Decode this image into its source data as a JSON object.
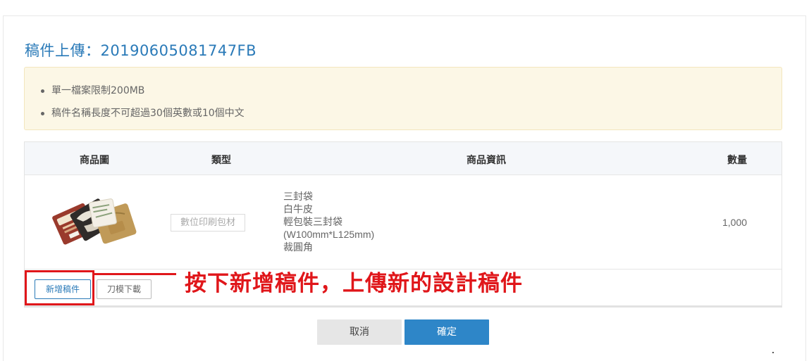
{
  "header": {
    "title_label": "稿件上傳：",
    "order_number": "20190605081747FB"
  },
  "notice": {
    "items": [
      "單一檔案限制200MB",
      "稿件名稱長度不可超過30個英數或10個中文"
    ]
  },
  "table": {
    "headers": {
      "image": "商品圖",
      "type": "類型",
      "info": "商品資訊",
      "quantity": "數量"
    },
    "rows": [
      {
        "type_tag": "數位印刷包材",
        "info_lines": [
          "三封袋",
          "白牛皮",
          "輕包裝三封袋",
          "(W100mm*L125mm)",
          "裁圓角"
        ],
        "quantity": "1,000"
      }
    ],
    "actions": {
      "add_file": "新增稿件",
      "download_template": "刀模下載"
    }
  },
  "annotation": {
    "text": "按下新增稿件，上傳新的設計稿件",
    "color": "#e0161a"
  },
  "footer": {
    "cancel": "取消",
    "confirm": "確定"
  },
  "colors": {
    "accent": "#2e86c8",
    "title": "#2a7ab8",
    "notice_bg": "#fcf7e6"
  }
}
